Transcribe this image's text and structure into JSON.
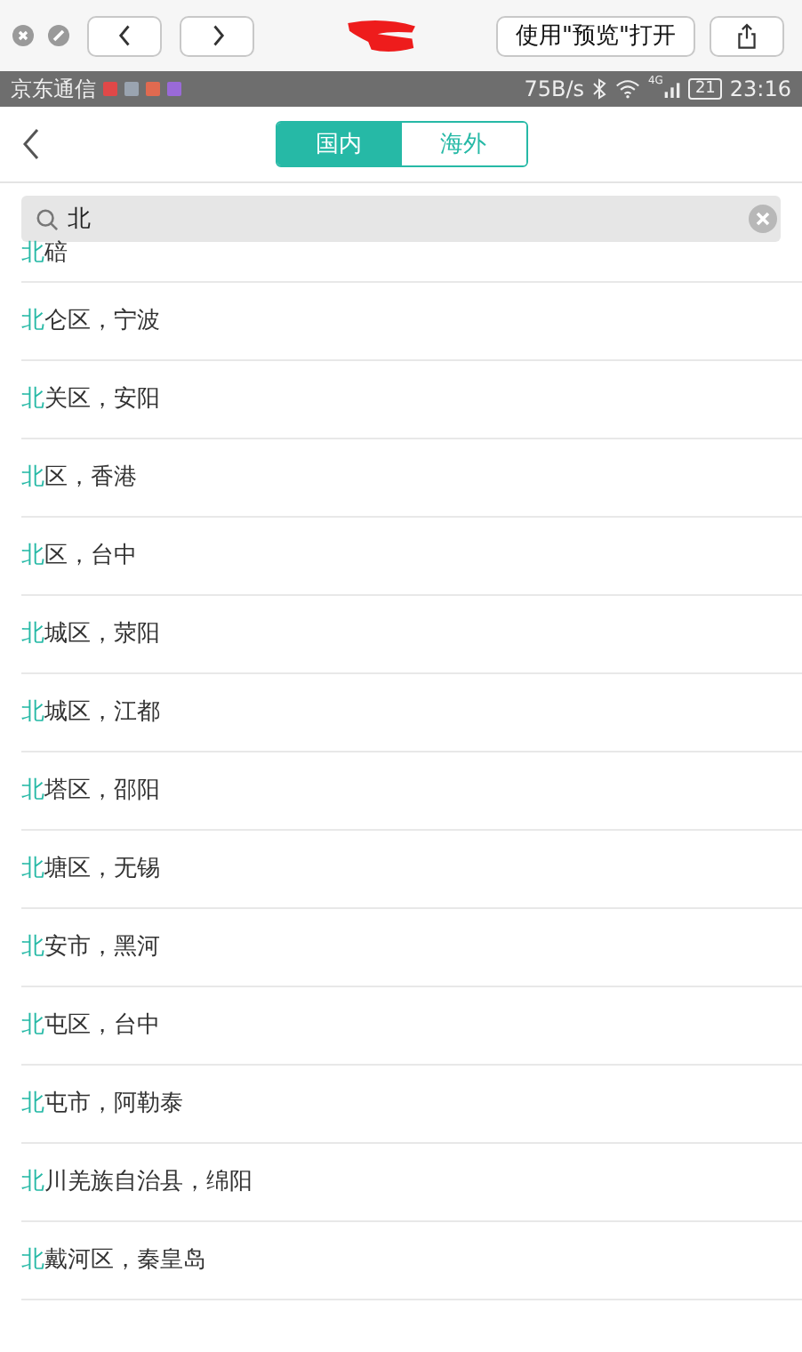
{
  "browser_bar": {
    "open_button": "使用\"预览\"打开"
  },
  "status_bar": {
    "carrier": "京东通信",
    "notifications": [
      {
        "color": "#e04848"
      },
      {
        "color": "#9aa4b0"
      },
      {
        "color": "#e06a50"
      },
      {
        "color": "#9a6ad8"
      }
    ],
    "speed": "75B/s",
    "network": "4G",
    "battery": "21",
    "time": "23:16"
  },
  "tabs": [
    {
      "label": "国内",
      "selected": true
    },
    {
      "label": "海外",
      "selected": false
    }
  ],
  "search": {
    "value": "北"
  },
  "results": [
    {
      "match": "北",
      "rest": "碚"
    },
    {
      "match": "北",
      "rest": "仑区，宁波"
    },
    {
      "match": "北",
      "rest": "关区，安阳"
    },
    {
      "match": "北",
      "rest": "区，香港"
    },
    {
      "match": "北",
      "rest": "区，台中"
    },
    {
      "match": "北",
      "rest": "城区，荥阳"
    },
    {
      "match": "北",
      "rest": "城区，江都"
    },
    {
      "match": "北",
      "rest": "塔区，邵阳"
    },
    {
      "match": "北",
      "rest": "塘区，无锡"
    },
    {
      "match": "北",
      "rest": "安市，黑河"
    },
    {
      "match": "北",
      "rest": "屯区，台中"
    },
    {
      "match": "北",
      "rest": "屯市，阿勒泰"
    },
    {
      "match": "北",
      "rest": "川羌族自治县，绵阳"
    },
    {
      "match": "北",
      "rest": "戴河区，秦皇岛"
    }
  ]
}
